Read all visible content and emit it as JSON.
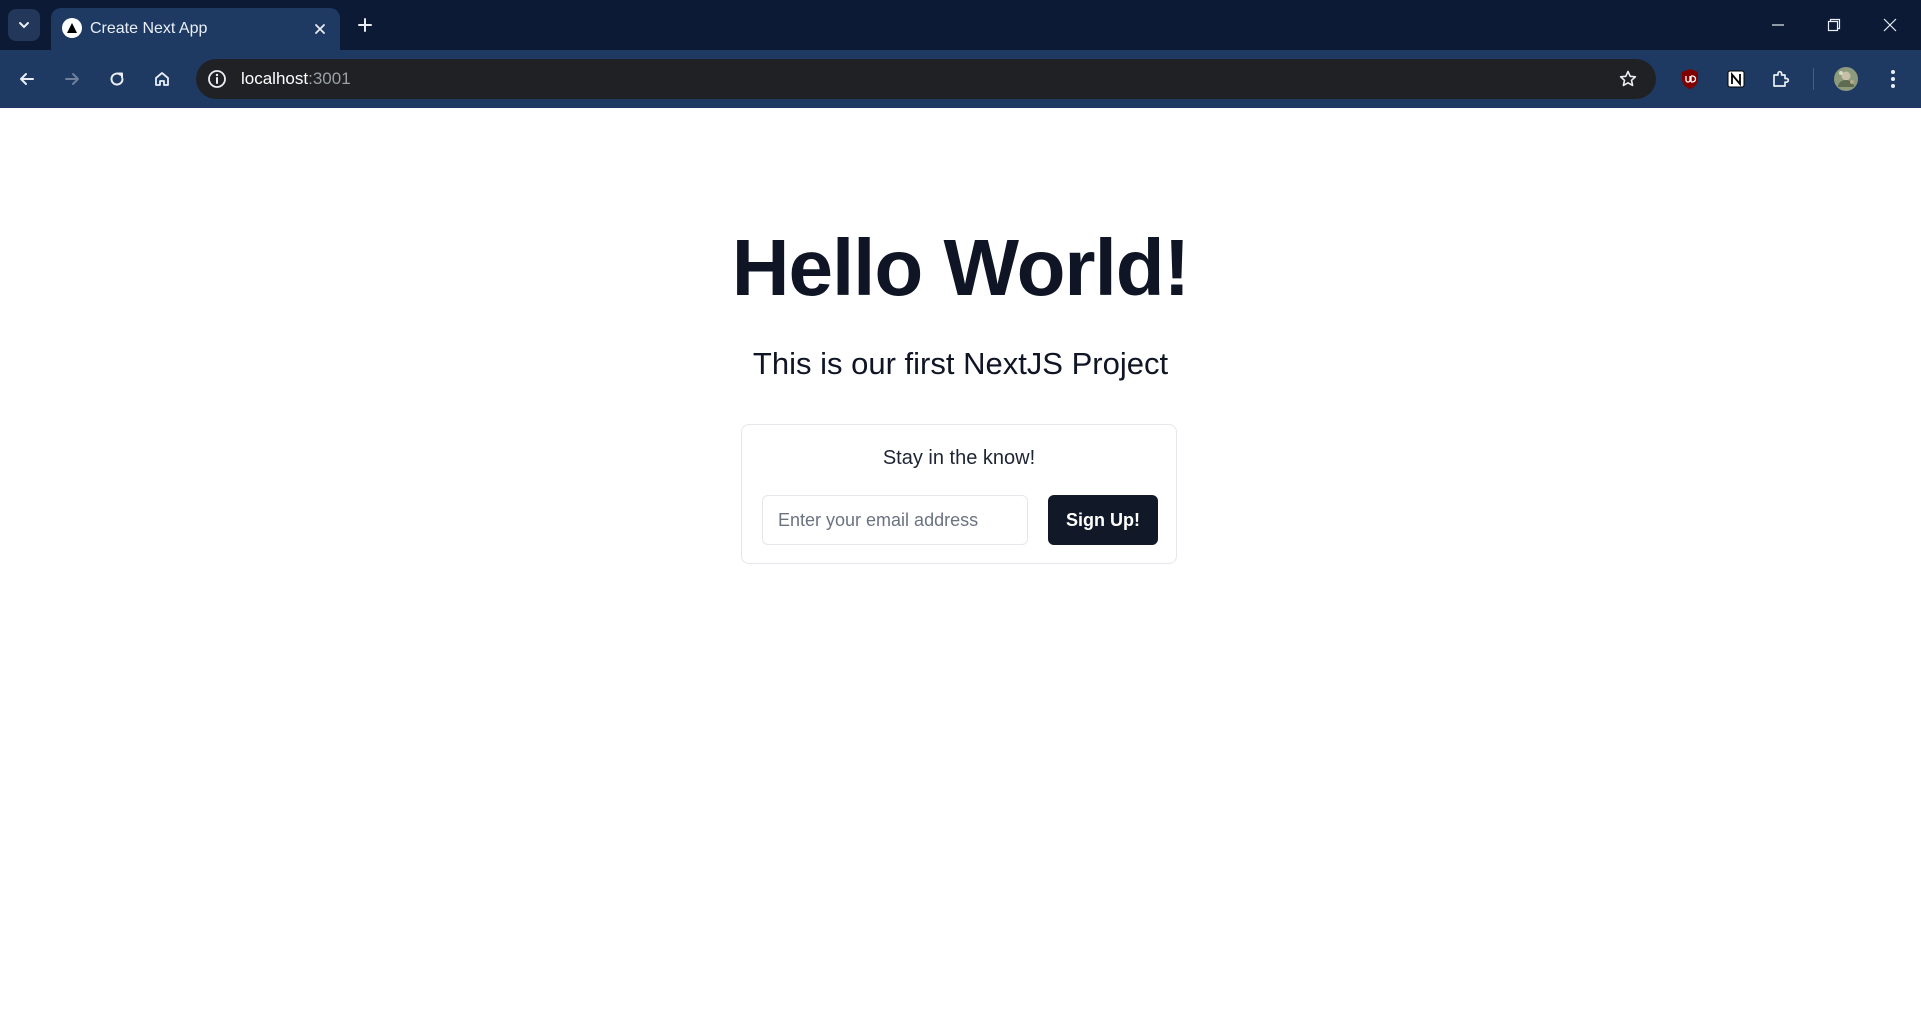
{
  "browser": {
    "tab": {
      "title": "Create Next App"
    },
    "address": {
      "host": "localhost",
      "port": ":3001"
    },
    "colors": {
      "frame": "#0c1a35",
      "toolbar": "#1e3a63",
      "omnibox": "#202124"
    },
    "icons": [
      "tab-search-icon",
      "nextjs-favicon-icon",
      "close-icon",
      "plus-icon",
      "minimize-icon",
      "restore-icon",
      "close-window-icon",
      "back-arrow-icon",
      "forward-arrow-icon",
      "reload-icon",
      "home-icon",
      "info-icon",
      "star-icon",
      "ublock-origin-icon",
      "notion-icon",
      "puzzle-piece-icon",
      "profile-avatar-icon",
      "kebab-menu-icon"
    ]
  },
  "page": {
    "heading": "Hello World!",
    "subtitle": "This is our first NextJS Project",
    "newsletter": {
      "title": "Stay in the know!",
      "email_placeholder": "Enter your email address",
      "button_label": "Sign Up!"
    },
    "colors": {
      "text": "#0f1524",
      "button": "#111827",
      "border": "#e4e7ec"
    }
  }
}
